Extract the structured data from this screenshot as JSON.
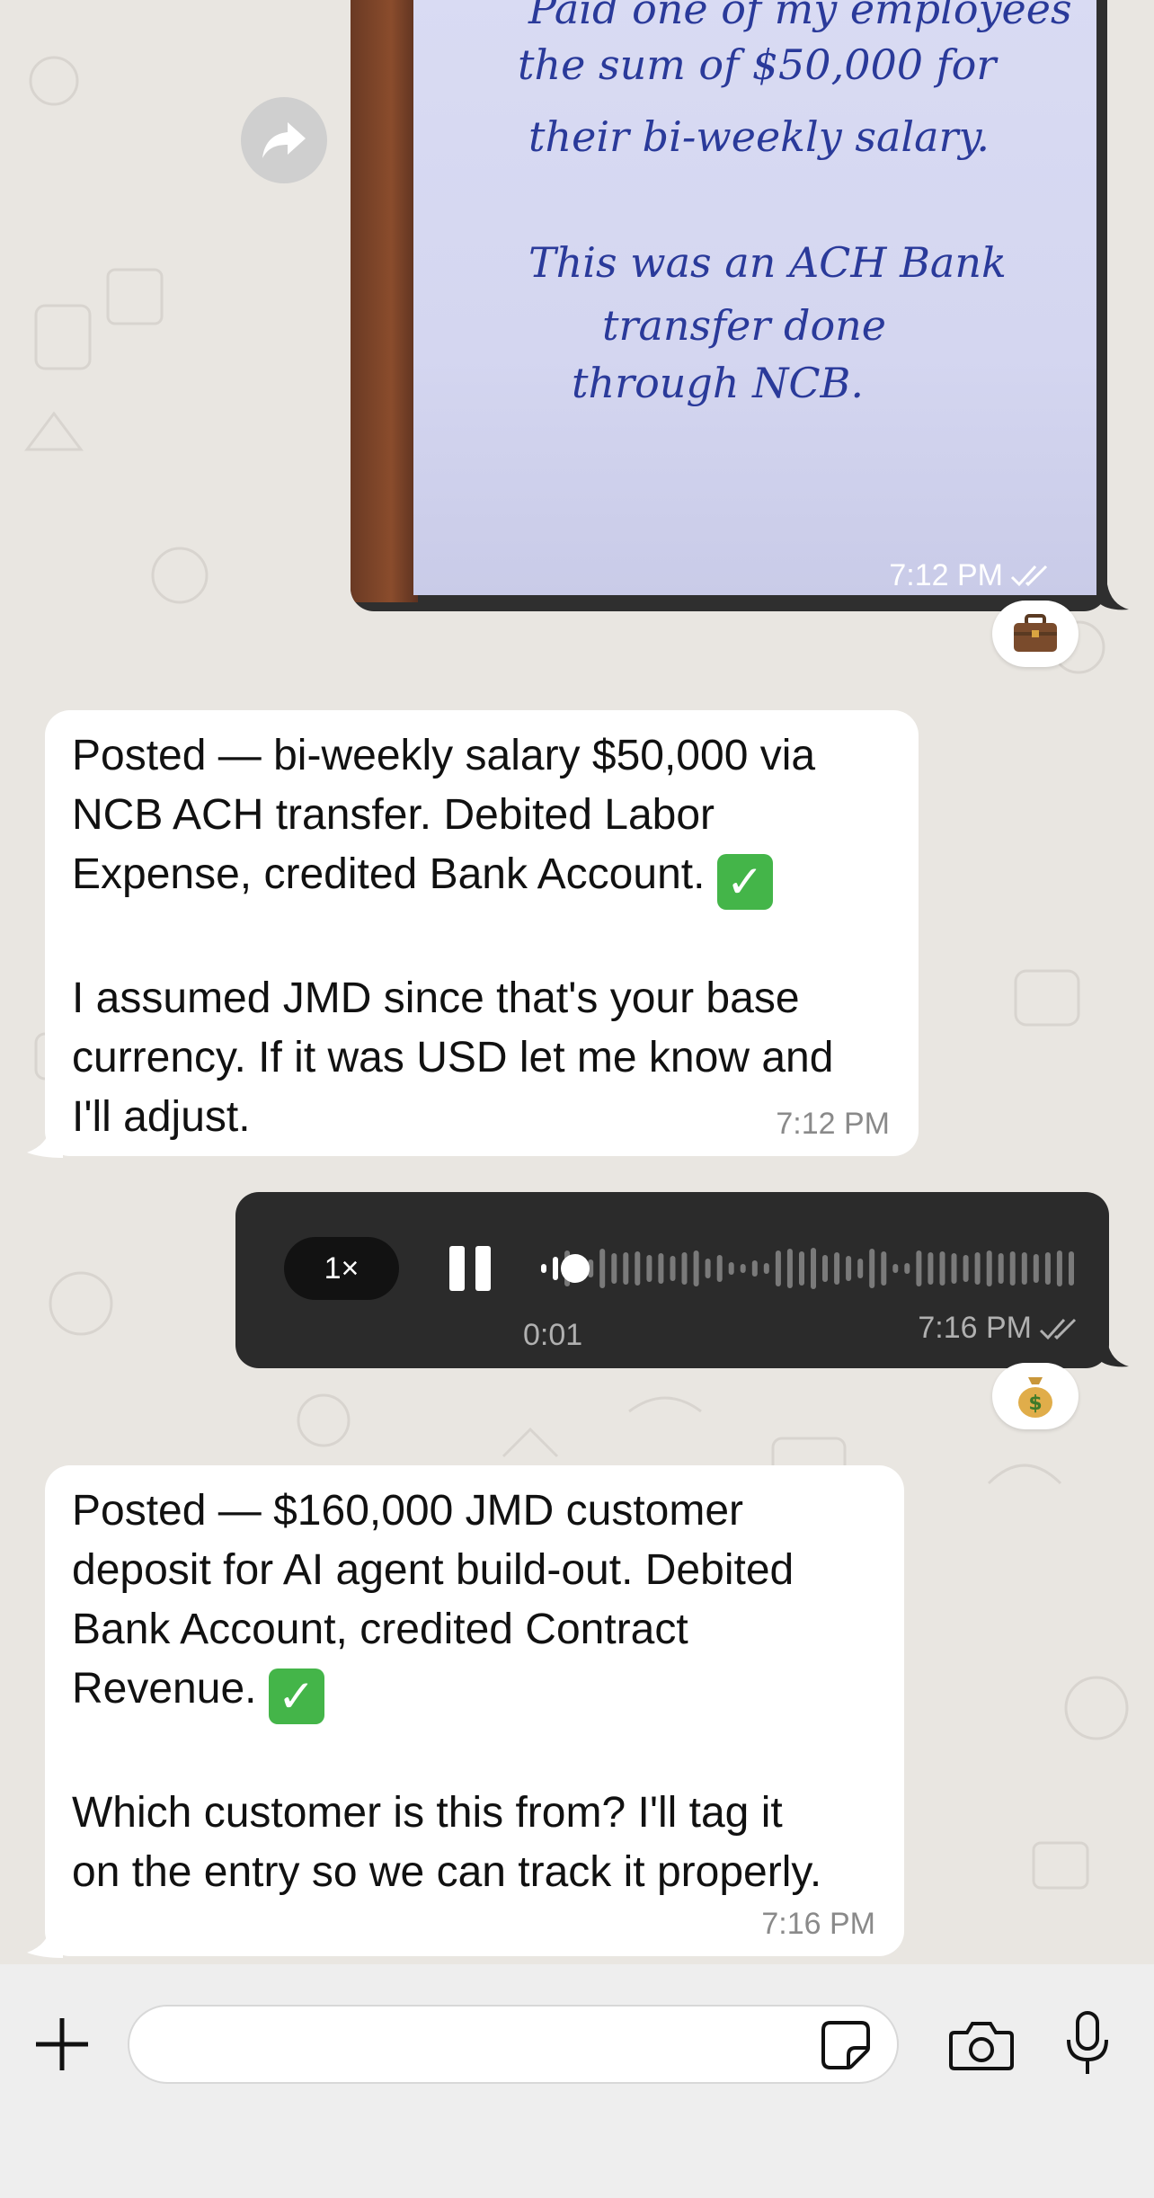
{
  "photo_message": {
    "handwriting": [
      "Paid one of my employees",
      "the sum of $50,000 for",
      "their bi-weekly salary.",
      "This was an ACH Bank",
      "transfer done",
      "through NCB."
    ],
    "time": "7:12 PM",
    "reaction": "briefcase-emoji"
  },
  "bot_message_1": {
    "line1": "Posted — bi-weekly salary $50,000 via",
    "line2": "NCB ACH transfer. Debited Labor",
    "line3": "Expense, credited Bank Account.",
    "line4": "I assumed JMD since that's your base",
    "line5": "currency. If it was USD let me know and",
    "line6": "I'll adjust.",
    "time": "7:12 PM"
  },
  "voice_message": {
    "speed": "1×",
    "duration": "0:01",
    "time": "7:16 PM",
    "progress": 0.04,
    "reaction": "money-bag-emoji"
  },
  "bot_message_2": {
    "line1": "Posted — $160,000 JMD customer",
    "line2": "deposit for AI agent build-out. Debited",
    "line3": "Bank Account, credited Contract",
    "line4": "Revenue.",
    "line5": "Which customer is this from? I'll tag it",
    "line6": "on the entry so we can track it properly.",
    "time": "7:16 PM"
  },
  "input_bar": {
    "message_value": "",
    "icons": [
      "plus-icon",
      "sticker-icon",
      "camera-icon",
      "microphone-icon"
    ]
  },
  "colors": {
    "background": "#e9e6e1",
    "incoming_bubble": "#ffffff",
    "voice_bubble": "#2b2b2b",
    "check_emoji": "#44b549"
  }
}
